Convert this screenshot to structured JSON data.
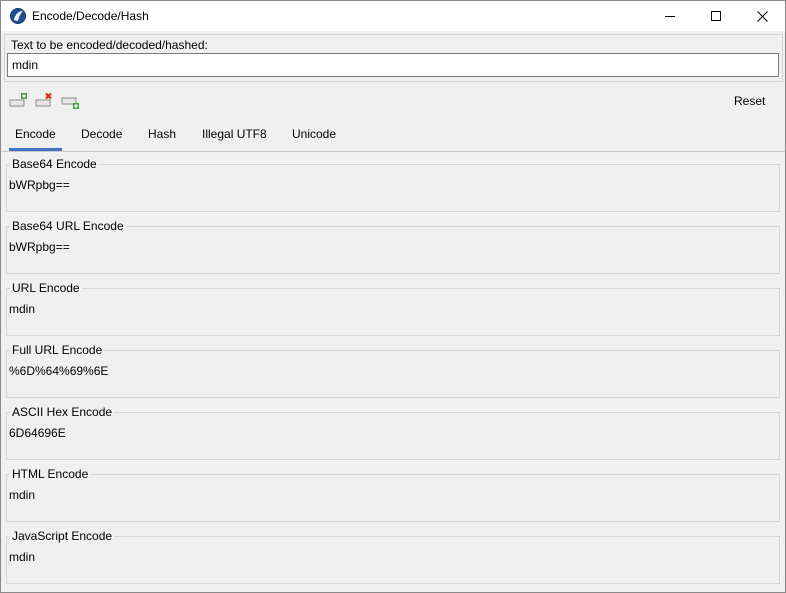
{
  "window": {
    "title": "Encode/Decode/Hash",
    "minimize_icon": "minimize-icon",
    "maximize_icon": "maximize-icon",
    "close_icon": "close-icon"
  },
  "input": {
    "label": "Text to be encoded/decoded/hashed:",
    "value": "mdin"
  },
  "toolbar": {
    "icons": [
      "add-icon",
      "remove-icon",
      "add-to-list-icon"
    ],
    "reset_label": "Reset"
  },
  "tabs": [
    {
      "label": "Encode",
      "active": true
    },
    {
      "label": "Decode",
      "active": false
    },
    {
      "label": "Hash",
      "active": false
    },
    {
      "label": "Illegal UTF8",
      "active": false
    },
    {
      "label": "Unicode",
      "active": false
    }
  ],
  "encodings": [
    {
      "label": "Base64 Encode",
      "value": "bWRpbg=="
    },
    {
      "label": "Base64 URL Encode",
      "value": "bWRpbg=="
    },
    {
      "label": "URL Encode",
      "value": "mdin"
    },
    {
      "label": "Full URL Encode",
      "value": "%6D%64%69%6E"
    },
    {
      "label": "ASCII Hex Encode",
      "value": "6D64696E"
    },
    {
      "label": "HTML Encode",
      "value": "mdin"
    },
    {
      "label": "JavaScript Encode",
      "value": "mdin"
    }
  ],
  "colors": {
    "active_tab_underline": "#4472c4",
    "window_background": "#f0f0f0"
  }
}
